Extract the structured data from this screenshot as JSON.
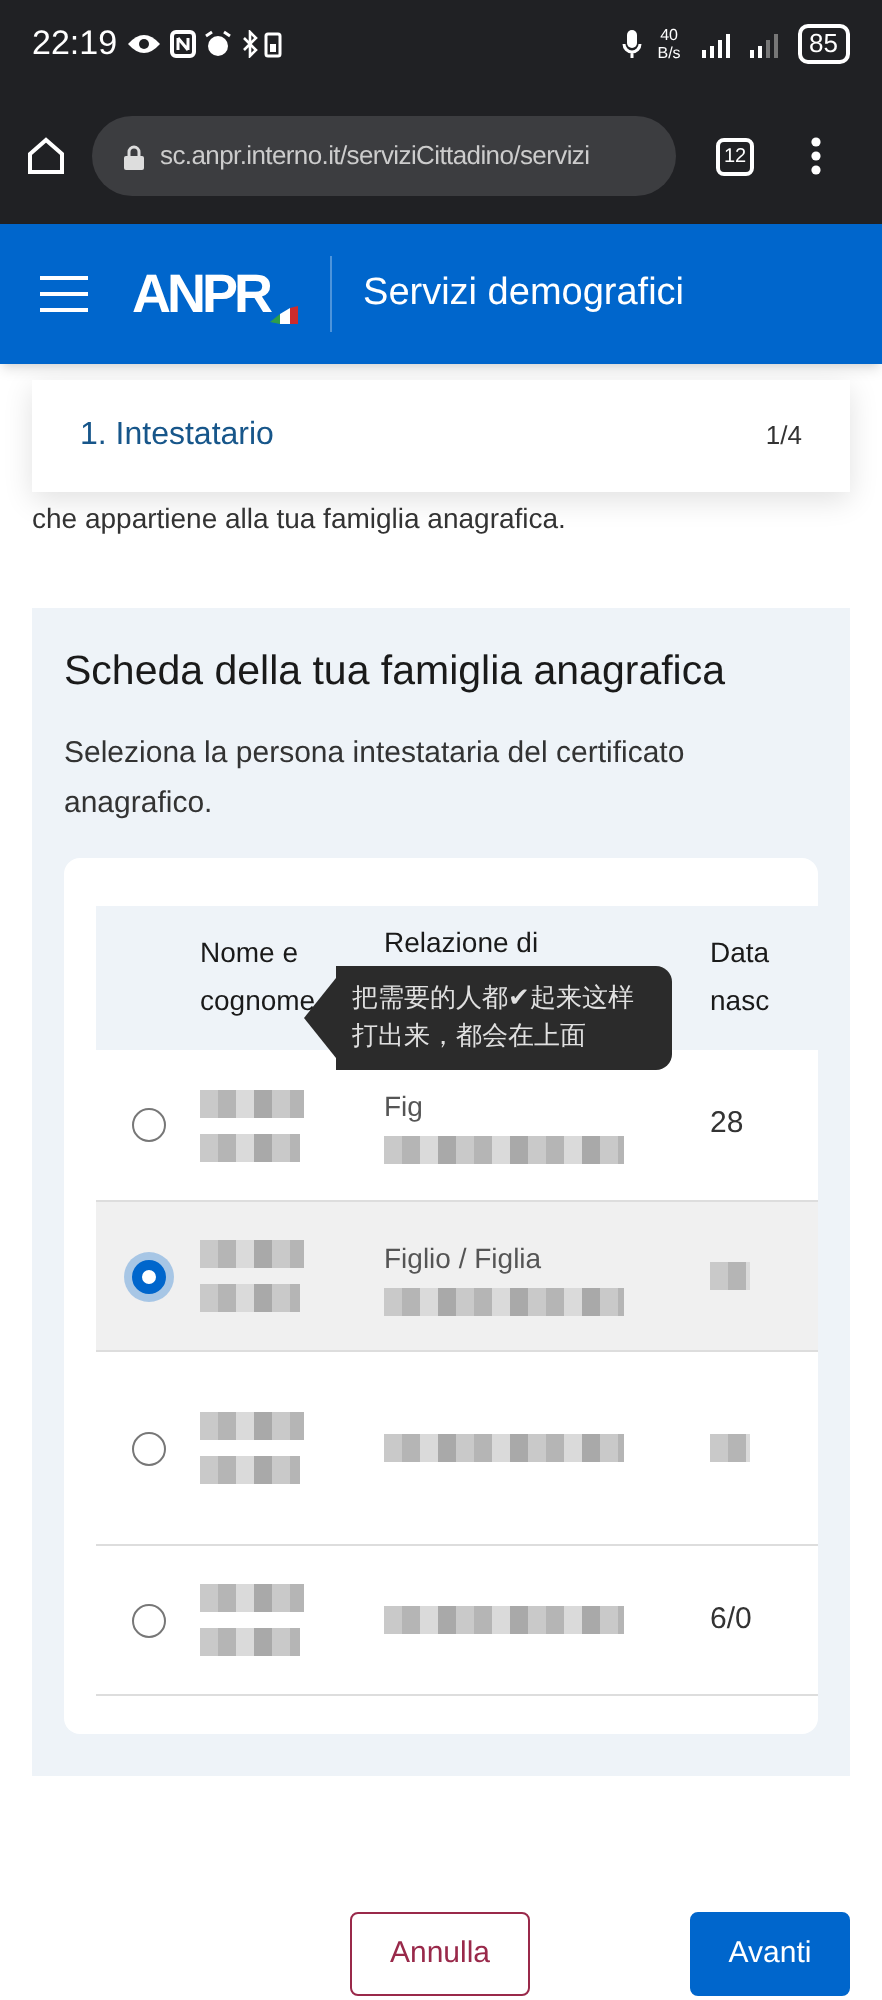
{
  "status_bar": {
    "time": "22:19",
    "net_speed": "40 B/s",
    "battery": "85"
  },
  "browser": {
    "url": "sc.anpr.interno.it/serviziCittadino/servizi",
    "tab_count": "12"
  },
  "header": {
    "logo": "ANPR",
    "title": "Servizi demografici"
  },
  "step": {
    "label": "1. Intestatario",
    "counter": "1/4"
  },
  "intro_tail": "che appartiene alla tua famiglia anagrafica.",
  "section": {
    "title": "Scheda della tua famiglia anagrafica",
    "description": "Seleziona la persona intestataria del certificato anagrafico."
  },
  "table": {
    "columns": [
      "Nome e cognome",
      "Relazione di",
      "Data nasc"
    ],
    "rows": [
      {
        "selected": false,
        "relation": "Fig",
        "date": "28"
      },
      {
        "selected": true,
        "relation": "Figlio / Figlia"
      },
      {
        "selected": false
      },
      {
        "selected": false,
        "date": "6/0"
      }
    ]
  },
  "tooltip": "把需要的人都✔起来这样打出来，都会在上面",
  "buttons": [
    {
      "label": "Annulla",
      "kind": "secondary"
    },
    {
      "label": "Avanti",
      "kind": "primary"
    }
  ]
}
